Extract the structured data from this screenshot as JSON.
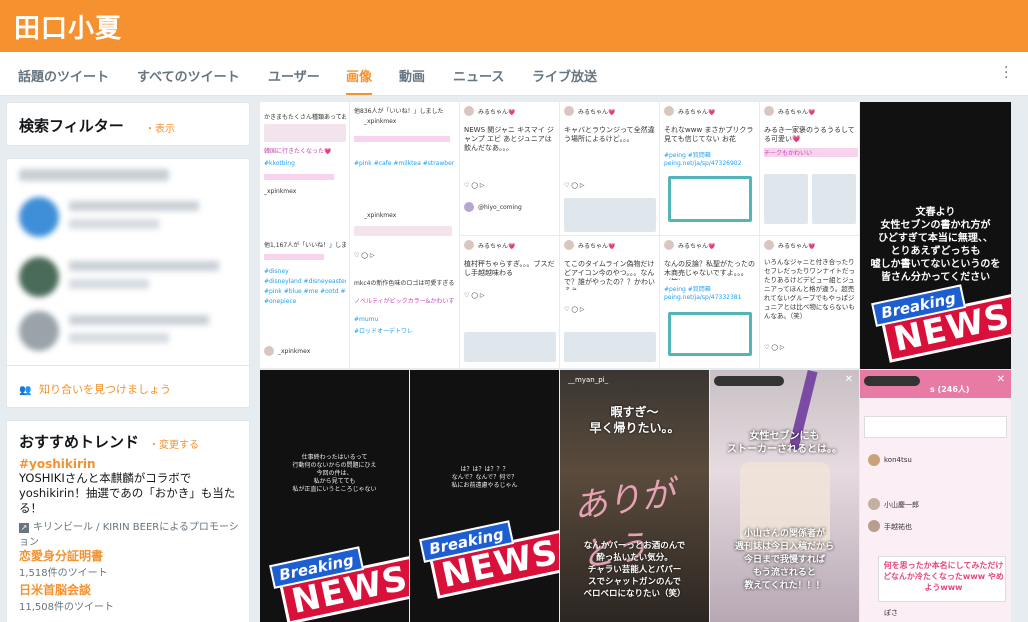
{
  "header": {
    "title": "田口小夏"
  },
  "tabs": [
    {
      "label": "話題のツイート",
      "active": false
    },
    {
      "label": "すべてのツイート",
      "active": false
    },
    {
      "label": "ユーザー",
      "active": false
    },
    {
      "label": "画像",
      "active": true
    },
    {
      "label": "動画",
      "active": false
    },
    {
      "label": "ニュース",
      "active": false
    },
    {
      "label": "ライブ放送",
      "active": false
    }
  ],
  "filter": {
    "title": "検索フィルター",
    "separator": "・",
    "show_link": "表示"
  },
  "suggest": {
    "find_friends": "知り合いを見つけましょう"
  },
  "trends": {
    "title": "おすすめトレンド",
    "separator": "・",
    "change_link": "変更する",
    "items": [
      {
        "name": "#yoshikirin",
        "desc": "YOSHIKIさんと本麒麟がコラボでyoshikirin！抽選であの「おかき」も当たる！",
        "promo": "キリンビール / KIRIN BEERによるプロモーション"
      },
      {
        "name": "恋愛身分証明書",
        "count": "1,518件のツイート"
      },
      {
        "name": "日米首脳会談",
        "count": "11,508件のツイート"
      }
    ]
  },
  "grid": {
    "t1": {
      "head": "かきまもたくさん種類あっておいし💗",
      "sub": "韓国に行きたくなった💗",
      "tags": "#kkotbing",
      "user": "_xpinkmex",
      "likes": "他1,167人が「いいね！」しました"
    },
    "t2": {
      "head": "他836人が「いいね！」しました",
      "user": "_xpinkmex",
      "mid": "_xpinkmex",
      "bottom": "ノベルティがビックカラー&かわいすぎ💗"
    },
    "t3": {
      "name": "みるちゃん💗",
      "text": "NEWS 関ジャニ キスマイ ジャンプ エビ あとジュニアは飲んだなあ。。。"
    },
    "t4": {
      "name": "みるちゃん💗",
      "text": "キャバとラウンジって全然違う場所によるけど。。。"
    },
    "t5": {
      "name": "みるちゃん💗",
      "text": "それなwww まさかプリクラ見ても信じてない お花",
      "tag": "#peing #質問箱 peing.net/ja/sp/47326902"
    },
    "t6": {
      "name": "みるちゃん💗",
      "text": "みるき一家褒のうるうるしてる可愛い💗",
      "pink": "チークもかわいい"
    },
    "t7": {
      "name": "みるちゃん💗",
      "text": "植村秤ちゃらすぎ。。。ブスだし手越越味わる"
    },
    "t8": {
      "name": "みるちゃん💗",
      "text": "てこのタイムライン偽物だけどアイコン今のやつ。。。なんで？誰がやったの？？かわいそう"
    },
    "t9": {
      "name": "みるちゃん💗",
      "text": "なんの反論？私聖がたったの木商売じゃないですよ。。。（笑）",
      "tag": "#peing #質問箱 peing.net/ja/sp/47332381"
    },
    "t10": {
      "name": "みるちゃん💗",
      "text": "いろんなジャニと付き合ったりセフレだったりワンナイトだったりあるけどデビュー組とジュニアってほんと格が違う。超売れてないグループでもやっぱジュニアとは比べ物にならないもんなあ。（笑）"
    },
    "d1": "文春より\n女性セブンの書かれ方が\nひどすぎて本当に無理、、\nとりあえずどっちも\n嘘しか書いてないというのを\n皆さん分かってください",
    "d2": "仕事終わったはいるって\n行動何のないからの問題にひえ\n今回の件は、\n私から見てても\n私が正直にいうところじゃない",
    "d3": "は？は？は？？？\nなんで？なんで？何で？\n私にお前遠慮やるじゃん",
    "s1": {
      "user": "__myan_pi_",
      "top": "暇すぎ〜\n早く帰りたい。。",
      "bottom": "なんかバーっとお酒のんで\n酔っ払いたい気分。\nチャラい芸能人とパパー\nスでシャットガンのんで\nベロベロになりたい（笑）"
    },
    "s2": {
      "top": "女性セブンにも\nストーカーされるとは。。",
      "bottom": "小山さんの関係者が\n週刊誌は今日入稿だから\n今日まで我慢すれば\nもう流されると\n教えてくれた！！！"
    },
    "s3": {
      "header": "s (246人)",
      "names": [
        "kon4tsu",
        "小山慶一郎",
        "手越祐也",
        "ぽさ"
      ],
      "bottom": "何を思ったか本名にしてみただけどなんか冷たくなったwww やめようwww"
    },
    "news_a": "Breaking",
    "news_b": "NEWS"
  }
}
